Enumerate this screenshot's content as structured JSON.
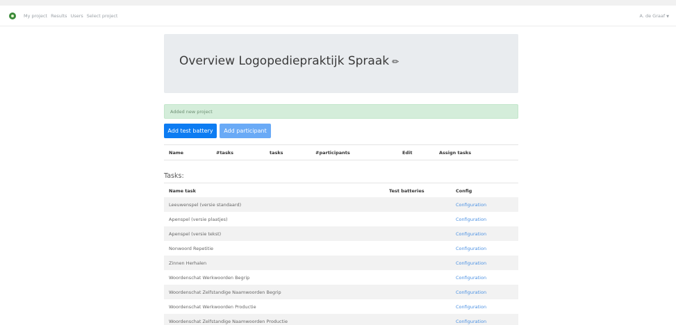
{
  "nav": {
    "links": [
      "My project",
      "Results",
      "Users",
      "Select project"
    ],
    "user": "A. de Graaf"
  },
  "page": {
    "title": "Overview Logopediepraktijk Spraak",
    "alert": "Added new project"
  },
  "buttons": {
    "add_test_battery": "Add test battery",
    "add_participant": "Add participant"
  },
  "battery_table": {
    "headers": [
      "Name",
      "#tasks",
      "tasks",
      "#participants",
      "Edit",
      "Assign tasks"
    ]
  },
  "tasks": {
    "title": "Tasks:",
    "headers": [
      "Name task",
      "Test batteries",
      "Config"
    ],
    "rows": [
      {
        "name": "Leeuwenspel (versie standaard)",
        "config": "Configuration"
      },
      {
        "name": "Apenspel (versie plaatjes)",
        "config": "Configuration"
      },
      {
        "name": "Apenspel (versie tekst)",
        "config": "Configuration"
      },
      {
        "name": "Nonwoord Repetitie",
        "config": "Configuration"
      },
      {
        "name": "Zinnen Herhalen",
        "config": "Configuration"
      },
      {
        "name": "Woordenschat Werkwoorden Begrip",
        "config": "Configuration"
      },
      {
        "name": "Woordenschat Zelfstandige Naamwoorden Begrip",
        "config": "Configuration"
      },
      {
        "name": "Woordenschat Werkwoorden Productie",
        "config": "Configuration"
      },
      {
        "name": "Woordenschat Zelfstandige Naamwoorden Productie",
        "config": "Configuration"
      }
    ]
  },
  "colors": {
    "primary": "#0d7cf2",
    "alert_bg": "#d4edda",
    "link": "#4a90e2"
  }
}
